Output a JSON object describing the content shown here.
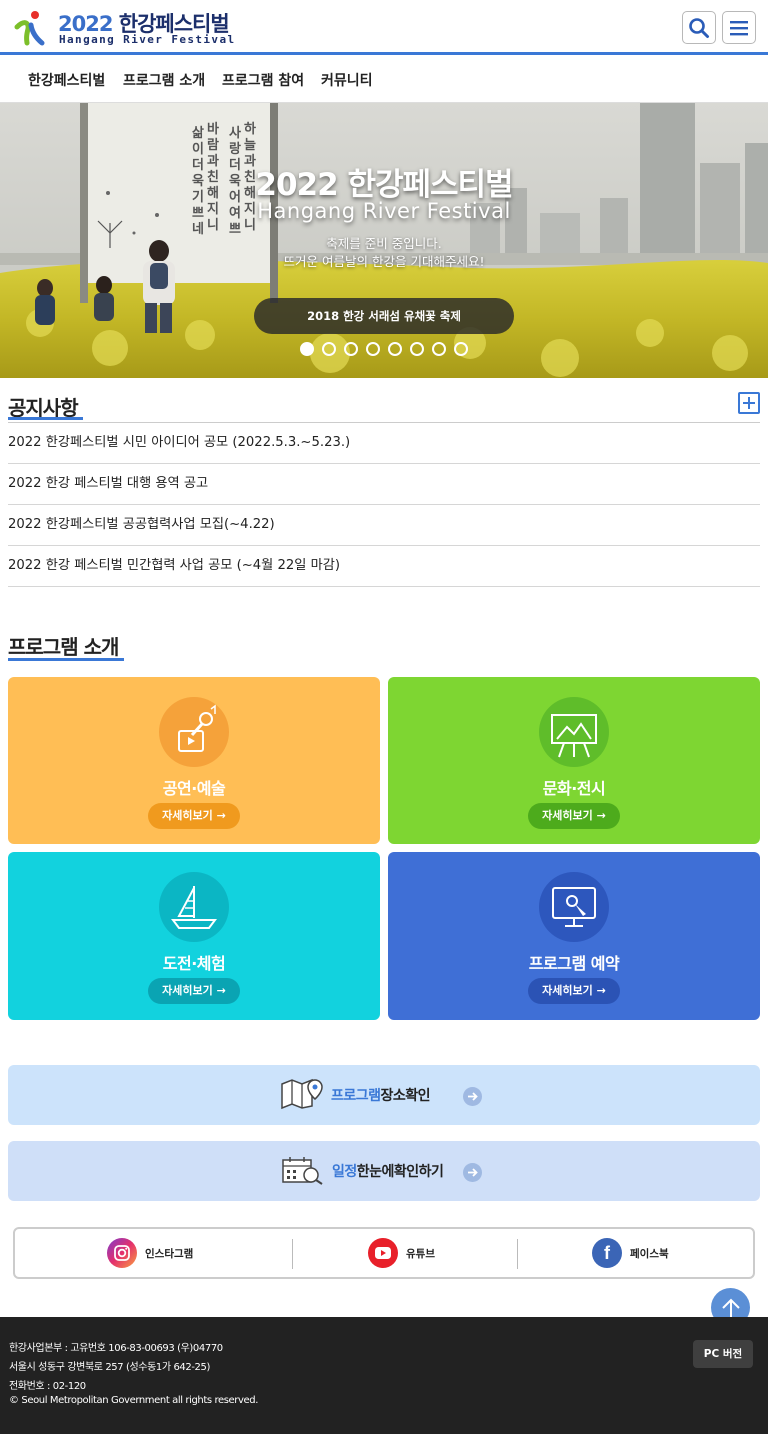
{
  "header": {
    "logo_year": "2022",
    "logo_kor": "한강페스티벌",
    "logo_sub": "Hangang River Festival"
  },
  "nav": {
    "items": [
      {
        "label": "한강페스티벌"
      },
      {
        "label": "프로그램 소개"
      },
      {
        "label": "프로그램 참여"
      },
      {
        "label": "커뮤니티"
      }
    ]
  },
  "hero": {
    "title": "2022 한강페스티벌",
    "subtitle": "Hangang River Festival",
    "desc_line1": "축제를 준비 중입니다.",
    "desc_line2": "뜨거운 여름날의 한강을 기대해주세요!",
    "caption": "2018 한강 서래섬 유채꽃 축제",
    "slide_count": 8,
    "active_slide": 1
  },
  "notices": {
    "title": "공지사항",
    "items": [
      "2022 한강페스티벌 시민 아이디어 공모 (2022.5.3.~5.23.)",
      "2022 한강 페스티벌 대행 용역 공고",
      "2022 한강페스티벌 공공협력사업 모집(~4.22)",
      "2022 한강 페스티벌 민간협력 사업 공모 (~4월 22일 마감)"
    ]
  },
  "programs": {
    "title": "프로그램 소개",
    "cards": [
      {
        "title": "공연·예술",
        "more": "자세히보기",
        "icon": "microphone-icon",
        "bg": "#ffbe55",
        "circle": "#f5a23a",
        "btn": "#f09a1e"
      },
      {
        "title": "문화·전시",
        "more": "자세히보기",
        "icon": "easel-icon",
        "bg": "#7ed632",
        "circle": "#5fbd2a",
        "btn": "#4dab1c"
      },
      {
        "title": "도전·체험",
        "more": "자세히보기",
        "icon": "sailboat-icon",
        "bg": "#12d2de",
        "circle": "#0bb6c4",
        "btn": "#0aa4b3"
      },
      {
        "title": "프로그램 예약",
        "more": "자세히보기",
        "icon": "touch-screen-icon",
        "bg": "#3f6fd6",
        "circle": "#2d57bd",
        "btn": "#2b53b5"
      }
    ]
  },
  "banners": [
    {
      "accent": "프로그램",
      "text": "장소확인",
      "icon": "map-pin-icon",
      "bg": "#cce3fb"
    },
    {
      "accent": "일정",
      "text": "한눈에확인하기",
      "icon": "calendar-search-icon",
      "bg": "#cfdff8"
    }
  ],
  "sns": [
    {
      "label": "인스타그램",
      "icon": "instagram-icon"
    },
    {
      "label": "유튜브",
      "icon": "youtube-icon"
    },
    {
      "label": "페이스북",
      "icon": "facebook-icon"
    }
  ],
  "footer": {
    "line1": "한강사업본부 : 고유번호 106-83-00693 (우)04770",
    "line2": "서울시 성동구 강변북로 257 (성수동1가 642-25)",
    "line3": "전화번호 : 02-120",
    "line4": "© Seoul Metropolitan Government all rights reserved.",
    "pc_label": "PC 버전"
  }
}
